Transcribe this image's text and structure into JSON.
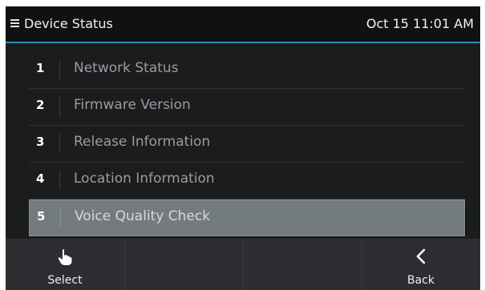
{
  "header": {
    "title": "Device Status",
    "datetime": "Oct 15 11:01 AM"
  },
  "menu": {
    "items": [
      {
        "num": "1",
        "label": "Network Status",
        "selected": false
      },
      {
        "num": "2",
        "label": "Firmware Version",
        "selected": false
      },
      {
        "num": "3",
        "label": "Release Information",
        "selected": false
      },
      {
        "num": "4",
        "label": "Location Information",
        "selected": false
      },
      {
        "num": "5",
        "label": "Voice Quality Check",
        "selected": true
      }
    ]
  },
  "softkeys": {
    "select_label": "Select",
    "back_label": "Back",
    "select_icon": "hand-pointer-icon",
    "back_icon": "chevron-left-icon"
  },
  "colors": {
    "accent": "#2e8fb8",
    "selected_row": "#737b7c",
    "background": "#1b1c1e"
  }
}
